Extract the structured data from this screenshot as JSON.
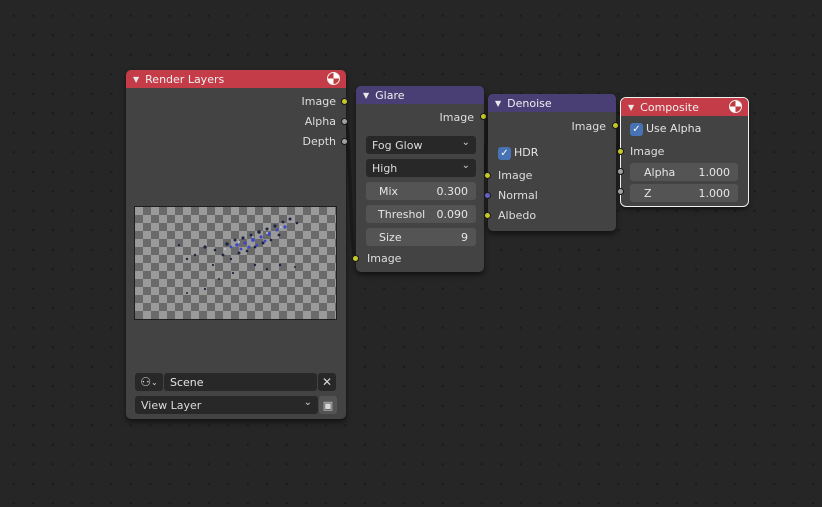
{
  "colors": {
    "canvas_bg": "#262626",
    "node_body": "#434343",
    "header_input": "#c43c47",
    "header_filter": "#4a3f75",
    "socket_color": "#c7c729",
    "socket_value": "#a1a1a1",
    "socket_vector": "#6363c7",
    "checkbox": "#4772b3"
  },
  "nodes": {
    "render_layers": {
      "title": "Render Layers",
      "icon": "render-node-icon",
      "outputs": [
        "Image",
        "Alpha",
        "Depth"
      ],
      "scene_icon": "scene-data-icon",
      "scene_value": "Scene",
      "clear_icon": "close-icon",
      "layer_value": "View Layer",
      "layer_button_icon": "render-layer-icon"
    },
    "glare": {
      "title": "Glare",
      "output": "Image",
      "glare_type": "Fog Glow",
      "quality": "High",
      "mix_label": "Mix",
      "mix_value": "0.300",
      "threshold_label": "Threshol",
      "threshold_value": "0.090",
      "size_label": "Size",
      "size_value": "9",
      "input": "Image"
    },
    "denoise": {
      "title": "Denoise",
      "output": "Image",
      "hdr_label": "HDR",
      "hdr_checked": true,
      "inputs": [
        "Image",
        "Normal",
        "Albedo"
      ]
    },
    "composite": {
      "title": "Composite",
      "icon": "render-node-icon",
      "use_alpha_label": "Use Alpha",
      "use_alpha_checked": true,
      "input_image": "Image",
      "alpha_label": "Alpha",
      "alpha_value": "1.000",
      "z_label": "Z",
      "z_value": "1.000"
    }
  }
}
